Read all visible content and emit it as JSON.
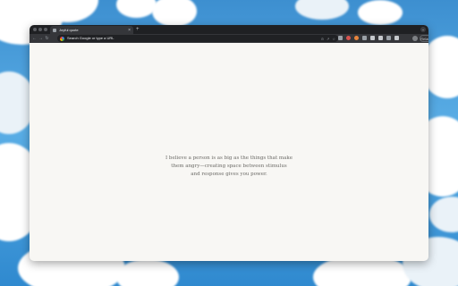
{
  "browser": {
    "tab_title": "Joyful quote",
    "tab_close": "×",
    "new_tab": "+",
    "tab_search": "⌄",
    "omnibox_placeholder": "Search Google or type a URL",
    "nav": {
      "back": "←",
      "forward": "→",
      "reload": "↻"
    },
    "omnibox_icons": {
      "cast": "⊙",
      "share": "↗",
      "bookmark": "☆"
    },
    "update_button": "Relaunch to update ⋮"
  },
  "quote": {
    "lines": [
      "I believe a person is as big as the things that make",
      "them angry—creating space between stimulus",
      "and response gives you power."
    ]
  },
  "colors": {
    "page_background": "#f8f7f4",
    "quote_text": "#6c6b67",
    "browser_chrome": "#35363a"
  }
}
